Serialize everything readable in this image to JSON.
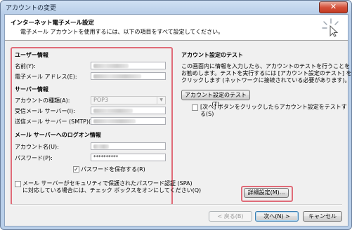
{
  "window": {
    "title": "アカウントの変更",
    "close_glyph": "✕"
  },
  "header": {
    "title": "インターネット電子メール設定",
    "subtitle": "電子メール アカウントを使用するには、以下の項目をすべて設定してください。",
    "icon": "wizard-cursor-icon"
  },
  "user_info": {
    "heading": "ユーザー情報",
    "name_label": "名前(Y):",
    "email_label": "電子メール アドレス(E):"
  },
  "server_info": {
    "heading": "サーバー情報",
    "account_type_label": "アカウントの種類(A):",
    "account_type_value": "POP3",
    "incoming_label": "受信メール サーバー(I):",
    "outgoing_label": "送信メール サーバー (SMTP)(O):"
  },
  "logon_info": {
    "heading": "メール サーバーへのログオン情報",
    "account_label": "アカウント名(U):",
    "password_label": "パスワード(P):",
    "password_value": "**********",
    "remember_password_label": "パスワードを保存する(R)",
    "remember_password_checked": true,
    "spa_label_line1": "メール サーバーがセキュリティで保護されたパスワード認証 (SPA)",
    "spa_label_line2": "に対応している場合には、チェック ボックスをオンにしてください(Q)",
    "spa_checked": false
  },
  "test_settings": {
    "heading": "アカウント設定のテスト",
    "desc_line1": "この画面内に情報を入力したら、アカウントのテストを行うことを",
    "desc_line2": "お勧めします。テストを実行するには [アカウント設定のテスト] を",
    "desc_line3": "クリックします (ネットワークに接続されている必要があります)。",
    "test_button": "アカウント設定のテスト(T)",
    "next_test_line1": "[次へ] ボタンをクリックしたらアカウント設定をテストす",
    "next_test_line2": "る(S)",
    "next_test_checked": false
  },
  "more_settings_button": "詳細設定(M)...",
  "footer": {
    "back_button": "< 戻る(B)",
    "next_button": "次へ(N) >",
    "cancel_button": "キャンセル"
  },
  "colors": {
    "highlight": "#e06b78",
    "dialog_bg": "#f0f0f0"
  }
}
